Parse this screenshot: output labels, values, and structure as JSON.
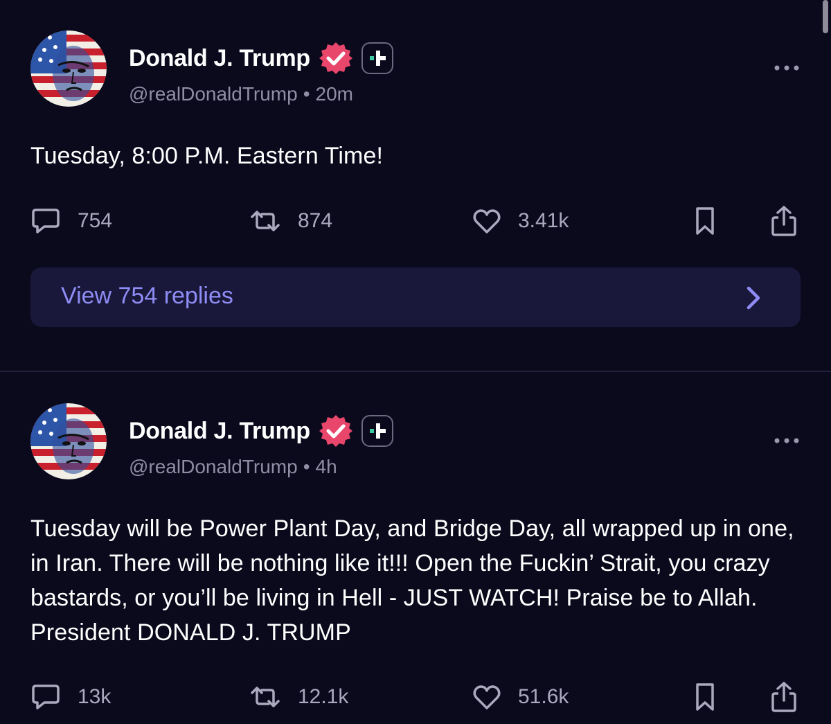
{
  "colors": {
    "background": "#0b0a1d",
    "text_primary": "#ffffff",
    "text_muted": "#8f8ea5",
    "verified_badge": "#e9466c",
    "plus_badge_mark": "#3ec8a0",
    "link_accent": "#8f8cf5",
    "replies_bar_bg": "#19183a"
  },
  "posts": [
    {
      "author_name": "Donald J. Trump",
      "handle": "@realDonaldTrump",
      "separator": "•",
      "time": "20m",
      "text": "Tuesday, 8:00 P.M. Eastern Time!",
      "replies": "754",
      "retruths": "874",
      "likes": "3.41k",
      "view_replies_label": "View 754 replies",
      "icons": {
        "avatar": "flag-portrait-avatar",
        "verified": "verified-badge-icon",
        "plus": "plus-badge-icon",
        "more": "more-options-icon",
        "reply": "reply-icon",
        "retruth": "retruth-icon",
        "like": "heart-icon",
        "bookmark": "bookmark-icon",
        "share": "share-icon",
        "chevron": "chevron-right-icon"
      }
    },
    {
      "author_name": "Donald J. Trump",
      "handle": "@realDonaldTrump",
      "separator": "•",
      "time": "4h",
      "text": "Tuesday will be Power Plant Day, and Bridge Day, all wrapped up in one, in Iran. There will be nothing like it!!! Open the Fuckin’ Strait, you crazy bastards, or you’ll be living in Hell - JUST WATCH! Praise be to Allah. President DONALD J. TRUMP",
      "replies": "13k",
      "retruths": "12.1k",
      "likes": "51.6k"
    }
  ]
}
